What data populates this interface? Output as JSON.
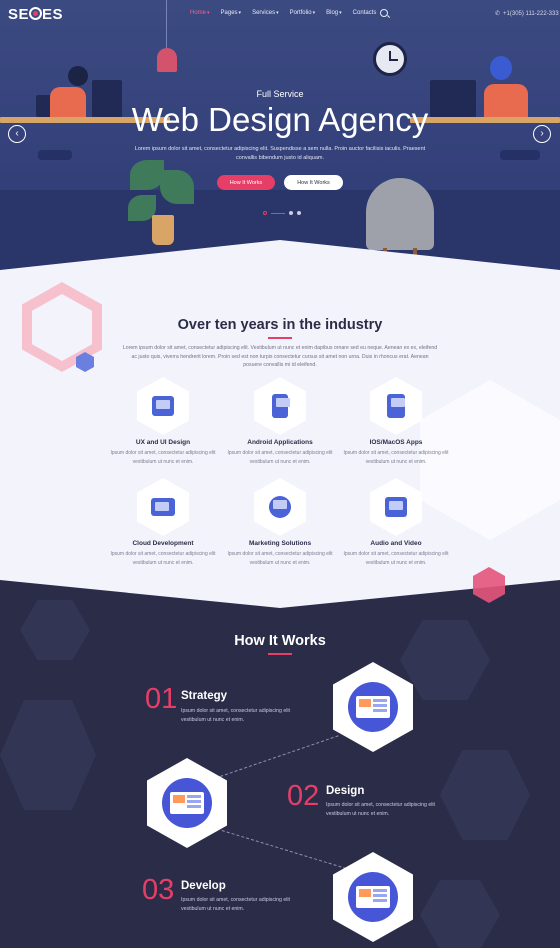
{
  "nav": {
    "logo": "SEOES",
    "links": [
      {
        "label": "Home",
        "active": true,
        "dropdown": true
      },
      {
        "label": "Pages",
        "active": false,
        "dropdown": true
      },
      {
        "label": "Services",
        "active": false,
        "dropdown": true
      },
      {
        "label": "Portfolio",
        "active": false,
        "dropdown": true
      },
      {
        "label": "Blog",
        "active": false,
        "dropdown": true
      },
      {
        "label": "Contacts",
        "active": false,
        "dropdown": false
      }
    ],
    "phone": "+1(305) 111-222-333"
  },
  "hero": {
    "subtitle": "Full Service",
    "title": "Web Design Agency",
    "text": "Lorem ipsum dolor sit amet, consectetur adipiscing elit. Suspendisse a sem nulla. Proin auctor facilisis iaculis. Praesent convallis bibendum justo id aliquam.",
    "primary_button": "How It Works",
    "secondary_button": "How It Works",
    "prev_arrow": "‹",
    "next_arrow": "›"
  },
  "services": {
    "title": "Over ten years in the industry",
    "text": "Lorem ipsum dolor sit amet, consectetur adipiscing elit. Vestibulum ut nunc et enim dapibus ornare sed eu neque. Aenean ex ex, eleifend ac justo quis, viverra hendrerit lorem. Proin sed est non turpis consectetur cursus sit amet non urna. Duis in rhoncus erat. Aenean posuere convallis mi id eleifend.",
    "items": [
      {
        "title": "UX and UI Design",
        "text": "Ipsum dolor sit amet, consectetur adipiscing elit vestibulum ut nunc et enim.",
        "icon": "monitor-icon"
      },
      {
        "title": "Android Applications",
        "text": "Ipsum dolor sit amet, consectetur adipiscing elit vestibulum ut nunc et enim.",
        "icon": "mobile-app-icon"
      },
      {
        "title": "IOS/MacOS Apps",
        "text": "Ipsum dolor sit amet, consectetur adipiscing elit vestibulum ut nunc et enim.",
        "icon": "app-store-icon"
      },
      {
        "title": "Cloud Development",
        "text": "Ipsum dolor sit amet, consectetur adipiscing elit vestibulum ut nunc et enim.",
        "icon": "cloud-folder-icon"
      },
      {
        "title": "Marketing Solutions",
        "text": "Ipsum dolor sit amet, consectetur adipiscing elit vestibulum ut nunc et enim.",
        "icon": "pie-chart-icon"
      },
      {
        "title": "Audio and Video",
        "text": "Ipsum dolor sit amet, consectetur adipiscing elit vestibulum ut nunc et enim.",
        "icon": "video-icon"
      }
    ]
  },
  "how": {
    "title": "How It Works",
    "steps": [
      {
        "num": "01",
        "title": "Strategy",
        "text": "Ipsum dolor sit amet, consectetur adipiscing elit vestibulum ut nunc et enim."
      },
      {
        "num": "02",
        "title": "Design",
        "text": "Ipsum dolor sit amet, consectetur adipiscing elit vestibulum ut nunc et enim."
      },
      {
        "num": "03",
        "title": "Develop",
        "text": "Ipsum dolor sit amet, consectetur adipiscing elit vestibulum ut nunc et enim."
      }
    ]
  },
  "colors": {
    "accent": "#e63e67",
    "dark": "#2b2d48",
    "hero": "#34417a",
    "blue": "#4a63d6"
  }
}
